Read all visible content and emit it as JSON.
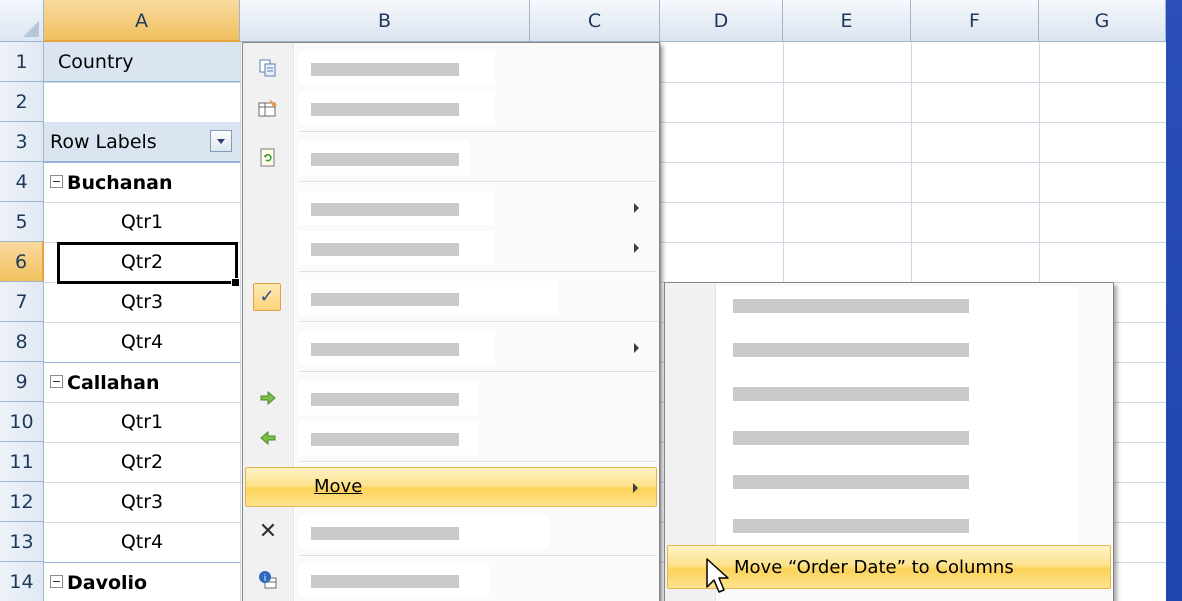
{
  "columns": [
    "A",
    "B",
    "C",
    "D",
    "E",
    "F",
    "G"
  ],
  "rows": [
    "1",
    "2",
    "3",
    "4",
    "5",
    "6",
    "7",
    "8",
    "9",
    "10",
    "11",
    "12",
    "13",
    "14"
  ],
  "cells": {
    "a1": "Country",
    "a2": "",
    "a3": "Row Labels",
    "a4": "Buchanan",
    "a5": "Qtr1",
    "a6": "Qtr2",
    "a7": "Qtr3",
    "a8": "Qtr4",
    "a9": "Callahan",
    "a10": "Qtr1",
    "a11": "Qtr2",
    "a12": "Qtr3",
    "a13": "Qtr4",
    "a14": "Davolio"
  },
  "selection": {
    "column": "A",
    "row": "6"
  },
  "context_menu": {
    "highlighted_item": "Move",
    "icons": [
      "copy-icon",
      "format-cells-icon",
      "refresh-icon",
      "check-icon",
      "expand-arrow-icon",
      "collapse-arrow-icon",
      "remove-x-icon",
      "field-settings-icon"
    ]
  },
  "submenu": {
    "highlighted_item": "Move “Order Date” to Columns"
  },
  "colors": {
    "header_selected": "#f1c15f",
    "menu_highlight": "#fde38e",
    "pivot_header_fill": "#dbe5f1",
    "background_blue": "#2a4fb8"
  }
}
